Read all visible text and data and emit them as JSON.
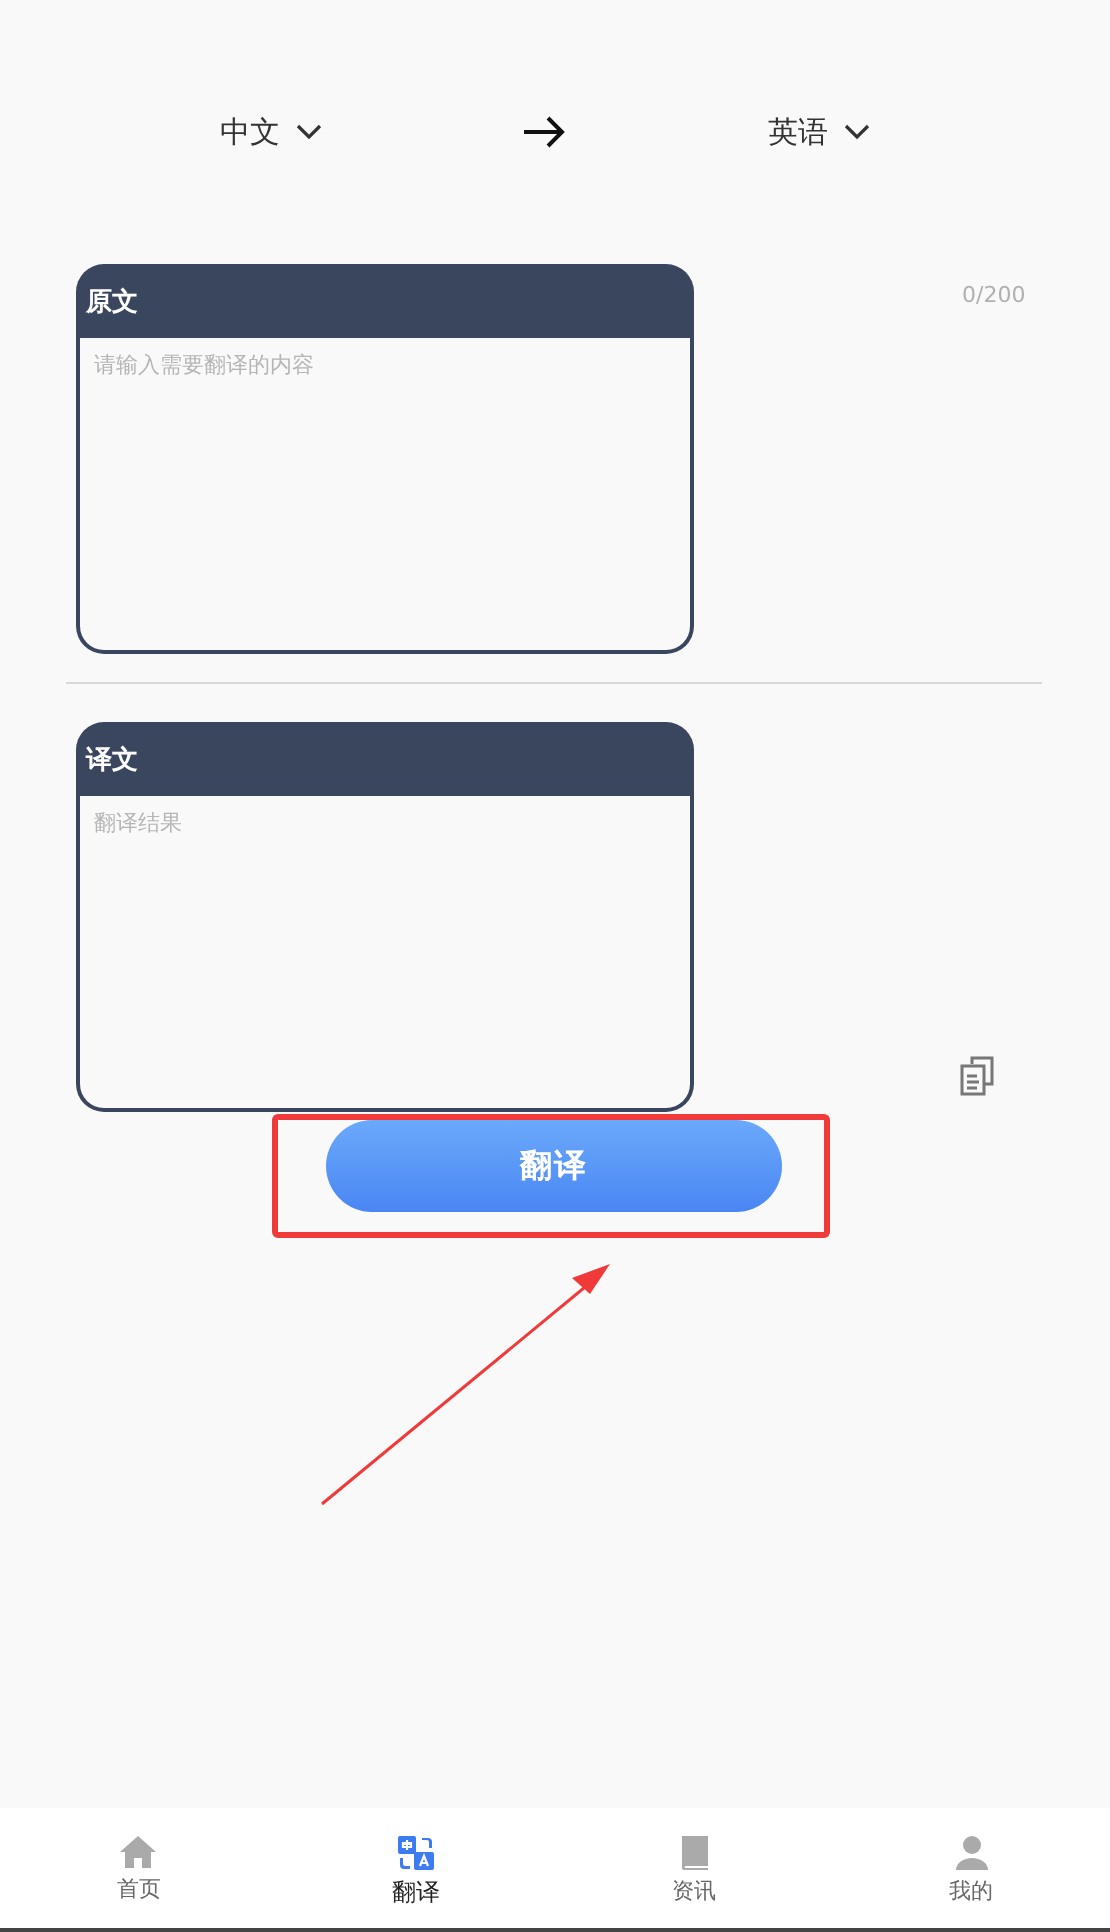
{
  "languages": {
    "source": "中文",
    "target": "英语"
  },
  "source_card": {
    "title": "原文",
    "placeholder": "请输入需要翻译的内容",
    "counter": "0/200"
  },
  "result_card": {
    "title": "译文",
    "placeholder": "翻译结果"
  },
  "translate_button": "翻译",
  "annotation": {
    "kind": "highlight-arrow"
  },
  "tabs": [
    {
      "label": "首页",
      "selected": false
    },
    {
      "label": "翻译",
      "selected": true
    },
    {
      "label": "资讯",
      "selected": false
    },
    {
      "label": "我的",
      "selected": false
    }
  ]
}
